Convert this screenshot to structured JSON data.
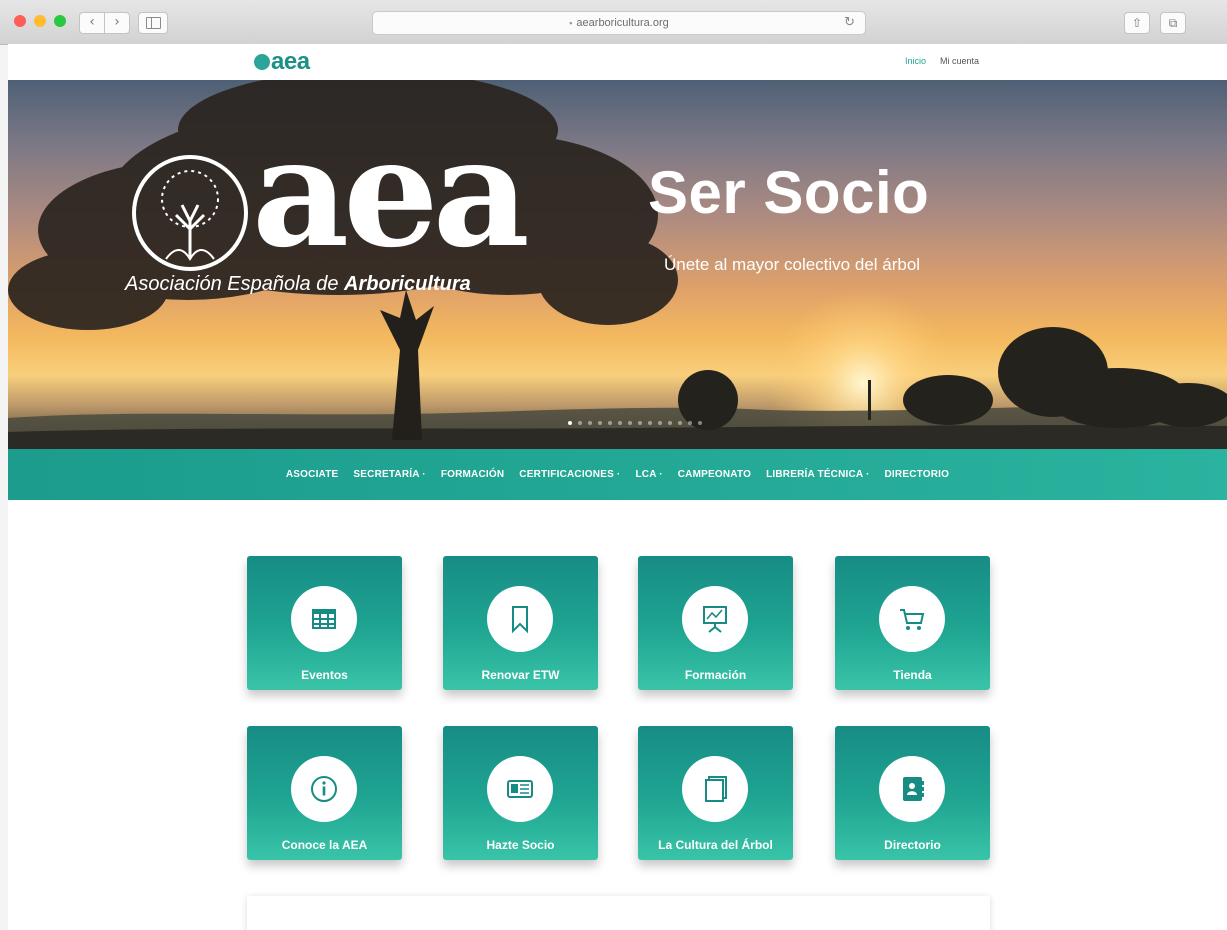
{
  "browser": {
    "url": "aearboricultura.org",
    "nav_back": "‹",
    "nav_forward": "›",
    "reload": "↻",
    "share": "⇧",
    "tabs": "⧉"
  },
  "site": {
    "logo_text": "aea",
    "top_links": [
      "Inicio",
      "Mi cuenta"
    ]
  },
  "hero": {
    "logo_word": "aea",
    "logo_subtitle_part1": "Asociación Española de",
    "logo_subtitle_part2": "Arboricultura",
    "title": "Ser Socio",
    "subtitle": "Únete al mayor colectivo del árbol"
  },
  "menu": {
    "items": [
      "ASOCIATE",
      "SECRETARÍA ·",
      "FORMACIÓN",
      "CERTIFICACIONES ·",
      "LCA ·",
      "CAMPEONATO",
      "LIBRERÍA TÉCNICA ·",
      "DIRECTORIO"
    ]
  },
  "tiles": [
    {
      "label": "Eventos",
      "icon": "calendar-table-icon"
    },
    {
      "label": "Renovar ETW",
      "icon": "bookmark-icon"
    },
    {
      "label": "Formación",
      "icon": "presentation-board-icon"
    },
    {
      "label": "Tienda",
      "icon": "shopping-cart-icon"
    },
    {
      "label": "Conoce la AEA",
      "icon": "info-icon"
    },
    {
      "label": "Hazte Socio",
      "icon": "id-card-icon"
    },
    {
      "label": "La Cultura del Árbol",
      "icon": "book-icon"
    },
    {
      "label": "Directorio",
      "icon": "address-book-icon"
    }
  ],
  "colors": {
    "accent": "#1fa592",
    "tile_top": "#178c85",
    "tile_bottom": "#39c4a8"
  }
}
